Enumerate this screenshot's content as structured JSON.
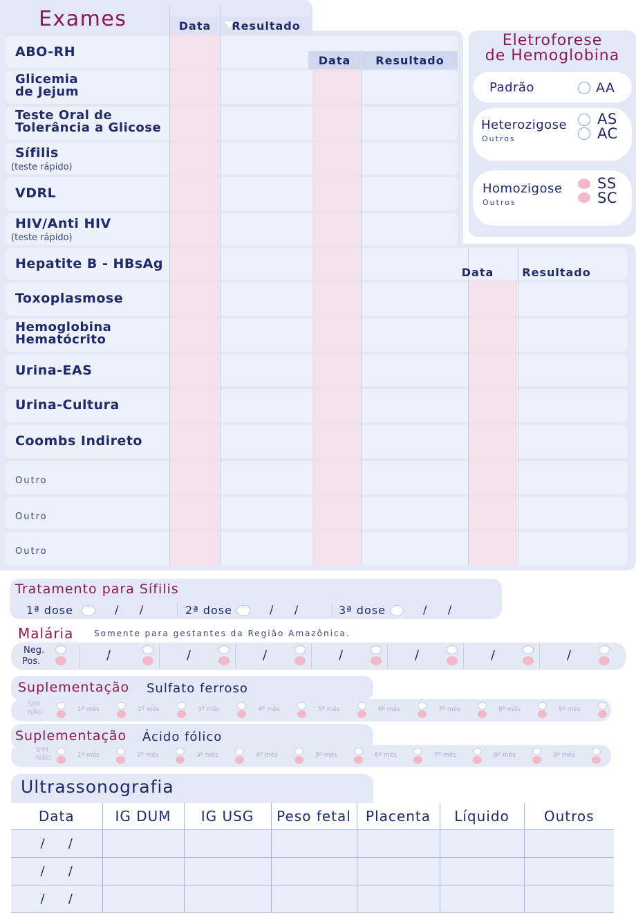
{
  "exames": {
    "title": "Exames",
    "col_data": "Data",
    "col_resultado": "Resultado",
    "col_data_b": "Data",
    "col_resultado_b": "Resultado",
    "col_data_c": "Data",
    "col_resultado_c": "Resultado",
    "rows": [
      {
        "label": "ABO-RH",
        "sub": ""
      },
      {
        "label": "Glicemia\nde Jejum",
        "sub": ""
      },
      {
        "label": "Teste Oral de\nTolerância a Glicose",
        "sub": ""
      },
      {
        "label": "Sífilis",
        "sub": "(teste rápido)"
      },
      {
        "label": "VDRL",
        "sub": ""
      },
      {
        "label": "HIV/Anti HIV",
        "sub": "(teste rápido)"
      },
      {
        "label": "Hepatite B - HBsAg",
        "sub": ""
      },
      {
        "label": "Toxoplasmose",
        "sub": ""
      },
      {
        "label": "Hemoglobina\nHematócrito",
        "sub": ""
      },
      {
        "label": "Urina-EAS",
        "sub": ""
      },
      {
        "label": "Urina-Cultura",
        "sub": ""
      },
      {
        "label": "Coombs Indireto",
        "sub": ""
      },
      {
        "label": "Outro",
        "sub": ""
      },
      {
        "label": "Outro",
        "sub": ""
      },
      {
        "label": "Outro",
        "sub": ""
      }
    ]
  },
  "eletroforese": {
    "title_line1": "Eletroforese",
    "title_line2": "de Hemoglobina",
    "padrao": "Padrão",
    "aa": "AA",
    "heterozigose": "Heterozigose",
    "outros_het": "Outros",
    "as": "AS",
    "ac": "AC",
    "homozigose": "Homozigose",
    "outros_hom": "Outros",
    "ss": "SS",
    "sc": "SC"
  },
  "sifilis": {
    "title": "Tratamento para Sífilis",
    "dose1": "1ª dose",
    "dose2": "2ª dose",
    "dose3": "3ª dose",
    "slash": "/      /"
  },
  "malaria": {
    "title": "Malária",
    "note": "Somente para gestantes da Região Amazônica.",
    "neg": "Neg.",
    "pos": "Pos.",
    "slash": "/"
  },
  "sulfato": {
    "title_a": "Suplementação",
    "title_b": "Sulfato ferroso",
    "sim": "SIM",
    "nao": "NÃO",
    "months": [
      "1º mês",
      "2º mês",
      "3º mês",
      "4º mês",
      "5º mês",
      "6º mês",
      "7º mês",
      "8º mês",
      "9º mês"
    ]
  },
  "acido": {
    "title_a": "Suplementação",
    "title_b": "Ácido fólico",
    "sim": "SIM",
    "nao": "NÃO",
    "months": [
      "1º mês",
      "2º mês",
      "3º mês",
      "4º mês",
      "5º mês",
      "6º mês",
      "7º mês",
      "8º mês",
      "9º mês"
    ]
  },
  "ultrassonografia": {
    "title": "Ultrassonografia",
    "headers": [
      "Data",
      "IG DUM",
      "IG USG",
      "Peso fetal",
      "Placenta",
      "Líquido",
      "Outros"
    ],
    "row_date": "/      /"
  },
  "colors": {
    "navy": "#1f2a6b",
    "maroon": "#8b1a52",
    "panel": "#e3e8f6",
    "pink": "#f2b8c8"
  }
}
